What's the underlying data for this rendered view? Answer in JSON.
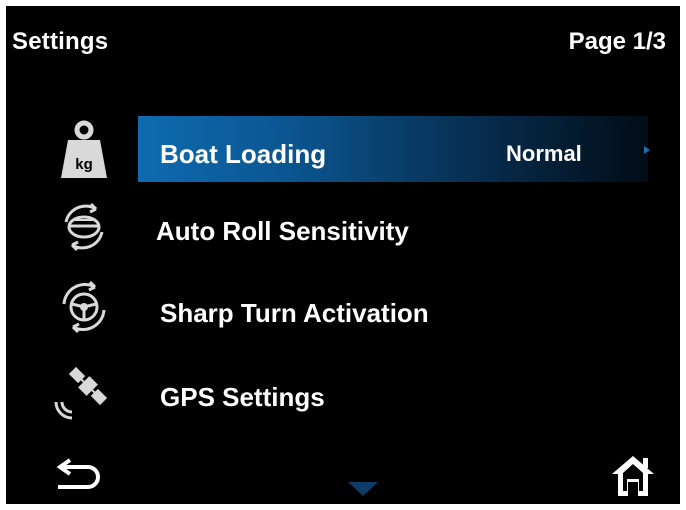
{
  "header": {
    "title": "Settings",
    "page_indicator": "Page 1/3"
  },
  "menu": {
    "items": [
      {
        "label": "Boat Loading",
        "value": "Normal",
        "icon": "weight-kg-icon",
        "icon_text": "kg",
        "selected": true
      },
      {
        "label": "Auto Roll Sensitivity",
        "icon": "auto-roll-boat-icon",
        "selected": false
      },
      {
        "label": "Sharp Turn Activation",
        "icon": "steering-wheel-icon",
        "selected": false
      },
      {
        "label": "GPS Settings",
        "icon": "satellite-icon",
        "selected": false
      }
    ]
  },
  "footer": {
    "back_icon": "back-arrow-icon",
    "home_icon": "home-icon",
    "scroll_icon": "scroll-down-icon"
  },
  "colors": {
    "background": "#000000",
    "text": "#ffffff",
    "highlight": "#0e6bb0",
    "icon": "#d9d9d9"
  }
}
